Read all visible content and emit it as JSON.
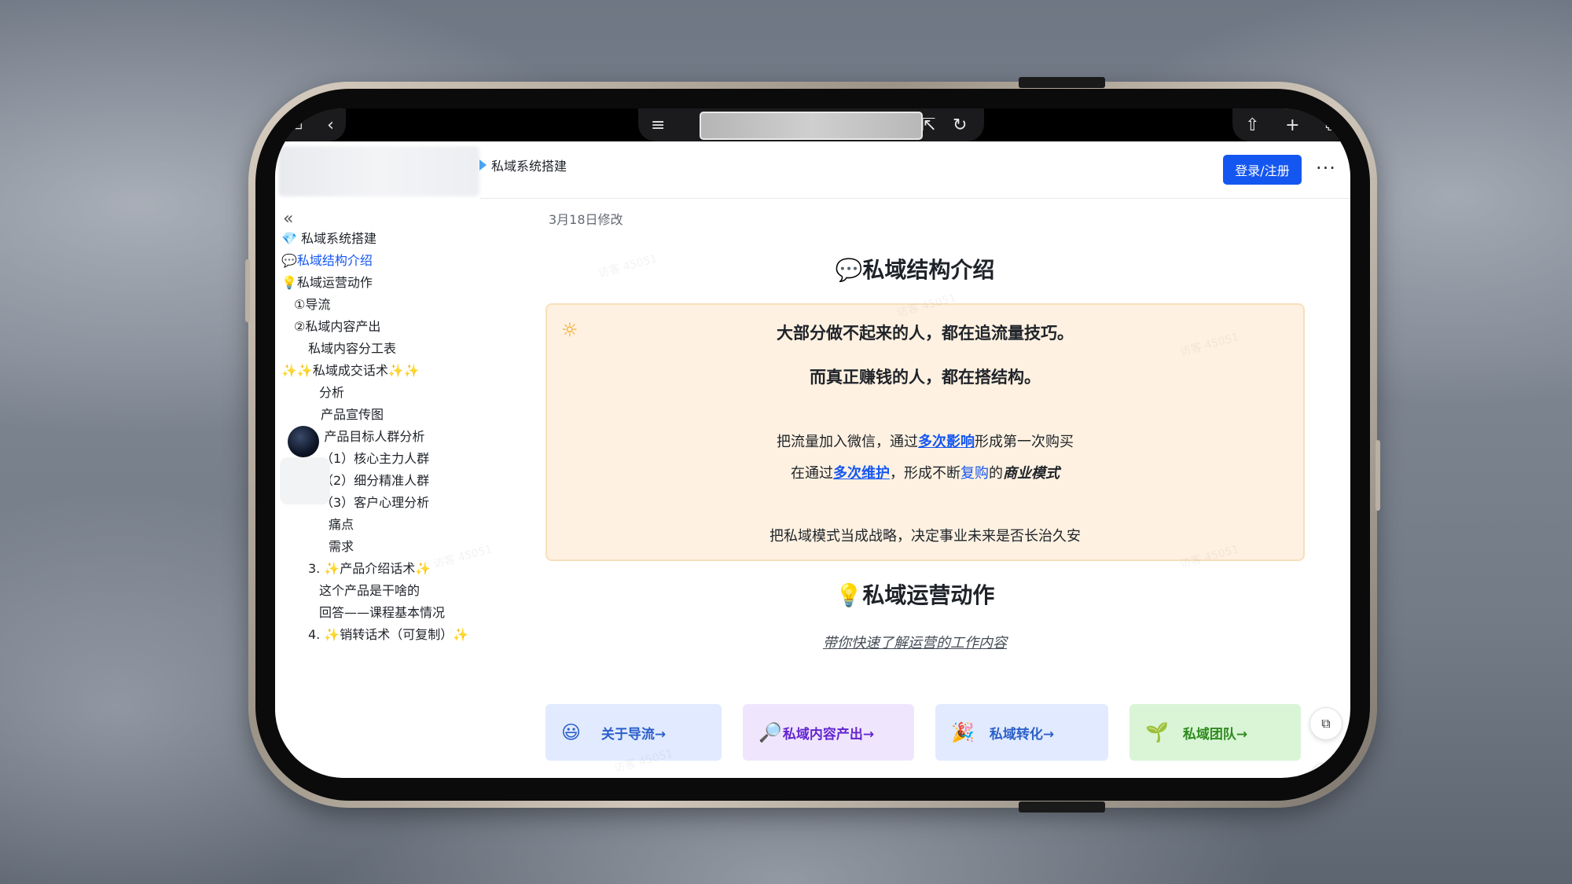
{
  "header": {
    "doc_title": "私域系统搭建",
    "login_label": "登录/注册",
    "more_label": "···"
  },
  "sidebar": {
    "items": [
      {
        "label": "💎 私域系统搭建"
      },
      {
        "label": "💬私域结构介绍",
        "active": true
      },
      {
        "label": "💡私域运营动作"
      },
      {
        "label": "①导流"
      },
      {
        "label": "②私域内容产出"
      },
      {
        "label": "私域内容分工表"
      },
      {
        "label": "✨✨私域成交话术✨✨"
      },
      {
        "label": "分析"
      },
      {
        "label": "产品宣传图"
      },
      {
        "label": "2. 产品目标人群分析"
      },
      {
        "label": "（1）核心主力人群"
      },
      {
        "label": "（2）细分精准人群"
      },
      {
        "label": "（3）客户心理分析"
      },
      {
        "label": "痛点"
      },
      {
        "label": "需求"
      },
      {
        "label": "3. ✨产品介绍话术✨"
      },
      {
        "label": "这个产品是干啥的"
      },
      {
        "label": "回答——课程基本情况"
      },
      {
        "label": "4. ✨销转话术（可复制）✨"
      }
    ]
  },
  "main": {
    "modified": "3月18日修改",
    "section1_title": "💬私域结构介绍",
    "callout": {
      "line1": "大部分做不起来的人，都在追流量技巧。",
      "line2": "而真正赚钱的人，都在搭结构。",
      "line3_a": "把流量加入微信，通过",
      "line3_link": "多次影响",
      "line3_b": "形成第一次购买",
      "line4_a": "在通过",
      "line4_link": "多次维护",
      "line4_b": "，形成不断",
      "line4_blue": "复购",
      "line4_c": "的",
      "line4_bold": "商业模式",
      "line5": "把私域模式当成战略，决定事业未来是否长治久安"
    },
    "section2_title": "💡私域运营动作",
    "section2_subtitle": "带你快速了解运营的工作内容",
    "cards": [
      {
        "emoji": "😃",
        "label": "关于导流→",
        "color": "#2b5fc9",
        "bg": "#e1eaff"
      },
      {
        "emoji": "🔎",
        "label": "私域内容产出→",
        "color": "#6425d0",
        "bg": "#efe6fd"
      },
      {
        "emoji": "🎉",
        "label": "私域转化→",
        "color": "#2b5fc9",
        "bg": "#e1eaff"
      },
      {
        "emoji": "🌱",
        "label": "私域团队→",
        "color": "#2e8a1e",
        "bg": "#d9f5d6"
      }
    ]
  },
  "watermark": "访客 45051"
}
